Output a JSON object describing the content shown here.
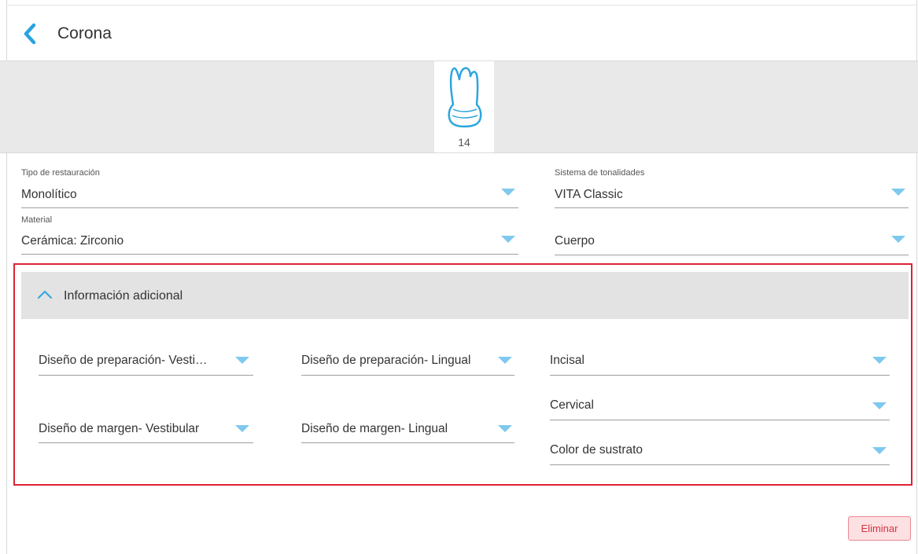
{
  "header": {
    "title": "Corona",
    "back_icon": "chevron-left-icon"
  },
  "tooth": {
    "number": "14",
    "icon": "tooth-icon"
  },
  "form": {
    "restoration_type": {
      "label": "Tipo de restauración",
      "value": "Monolítico"
    },
    "shade_system": {
      "label": "Sistema de tonalidades",
      "value": "VITA Classic"
    },
    "material": {
      "label": "Material",
      "value": "Cerámica: Zirconio"
    },
    "body": {
      "value": "Cuerpo"
    }
  },
  "additional": {
    "title": "Información adicional",
    "expanded": true,
    "prep_design_buccal": "Diseño de preparación- Vesti…",
    "prep_design_lingual": "Diseño de preparación- Lingual",
    "incisal": "Incisal",
    "cervical": "Cervical",
    "margin_design_buccal": "Diseño de margen- Vestibular",
    "margin_design_lingual": "Diseño de margen- Lingual",
    "substrate_color": "Color de sustrato"
  },
  "actions": {
    "delete_label": "Eliminar"
  },
  "colors": {
    "accent": "#7fc8ee",
    "back_arrow": "#29a3e0",
    "highlight": "#dc2433",
    "delete_text": "#cf3542"
  }
}
